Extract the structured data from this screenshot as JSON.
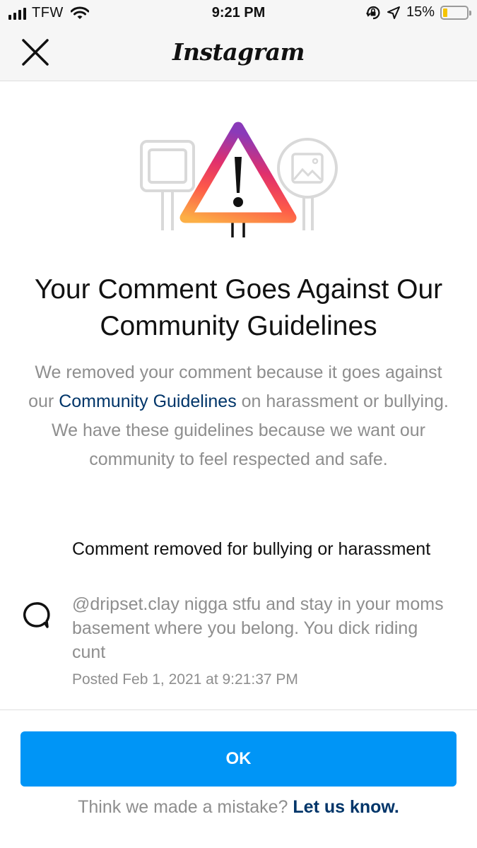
{
  "status_bar": {
    "carrier": "TFW",
    "time": "9:21 PM",
    "battery": "15%",
    "battery_level": 0.15,
    "icons": [
      "signal-icon",
      "wifi-icon",
      "orientation-lock-icon",
      "location-icon",
      "battery-icon"
    ]
  },
  "nav": {
    "title": "Instagram",
    "close_icon": "close-icon"
  },
  "illustration": {
    "name": "warning-triangle-illustration",
    "gradient": [
      "#8a3ab9",
      "#e1306c",
      "#fd1d1d",
      "#fcaf45"
    ],
    "side_icons": [
      "speech-bubble-sign-icon",
      "image-sign-icon"
    ]
  },
  "main": {
    "headline": "Your Comment Goes Against Our Community Guidelines",
    "body_before": "We removed your comment because it goes against our ",
    "body_link": "Community Guidelines",
    "body_after": " on harassment or bullying. We have these guidelines because we want our community to feel respected and safe."
  },
  "comment": {
    "icon": "comment-bubble-icon",
    "title": "Comment removed for bullying or harassment",
    "text": "@dripset.clay nigga stfu and stay in your moms basement where you belong. You dick riding cunt",
    "posted": "Posted Feb 1, 2021 at 9:21:37 PM"
  },
  "actions": {
    "ok_label": "OK",
    "footer_text": "Think we made a mistake? ",
    "footer_link": "Let us know."
  },
  "colors": {
    "primary_button": "#0095f6",
    "link": "#003569",
    "secondary_text": "#8e8e8e"
  }
}
